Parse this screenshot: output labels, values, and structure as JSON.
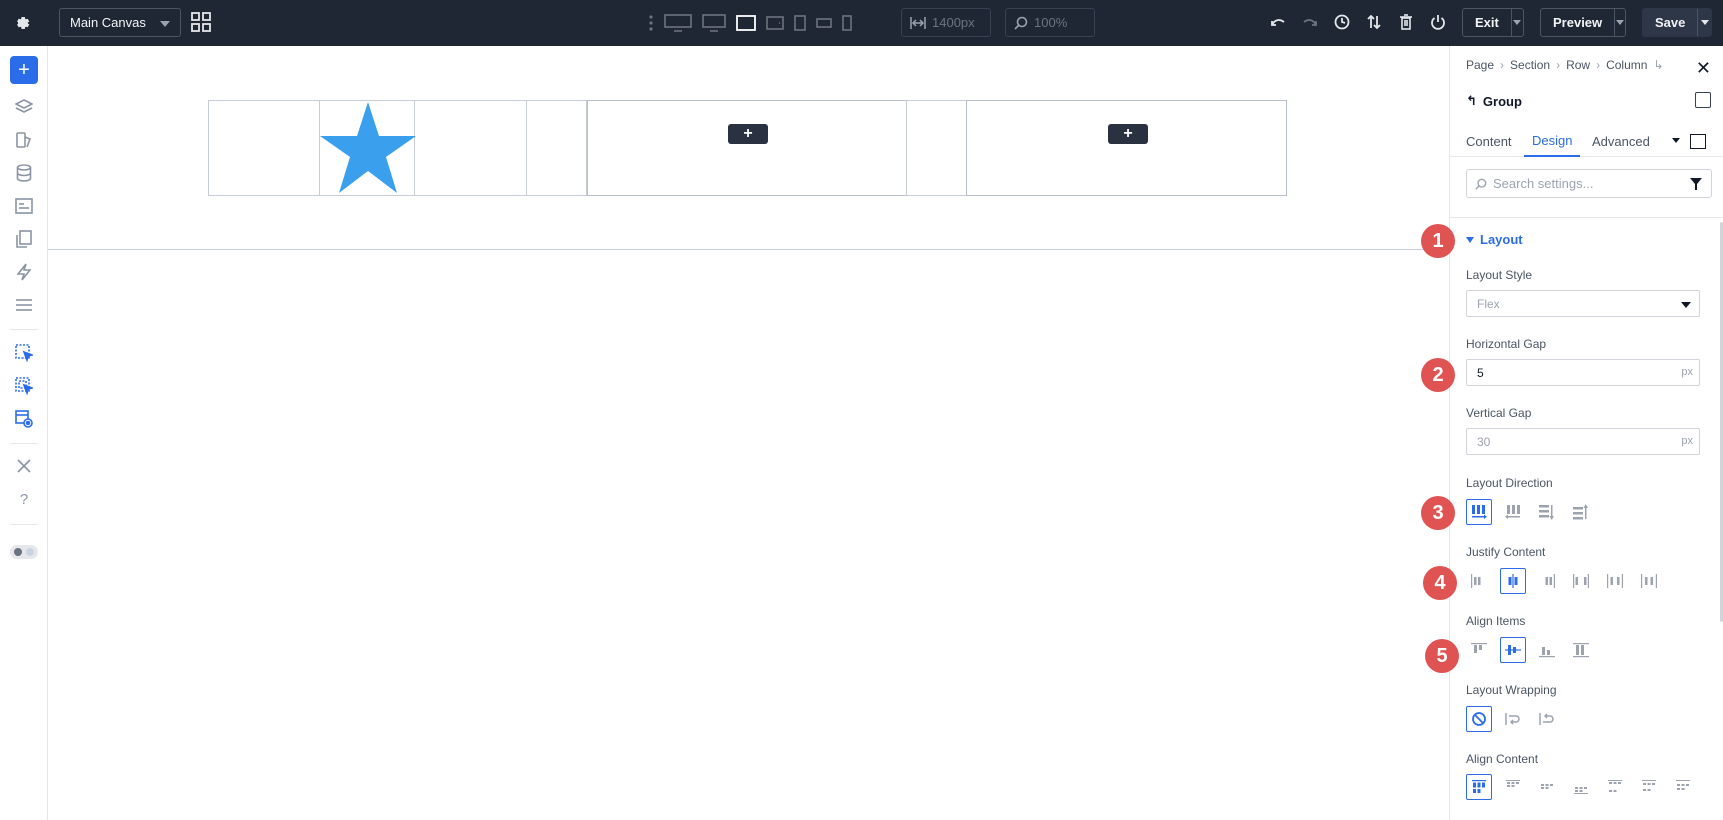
{
  "topbar": {
    "canvas_select": "Main Canvas",
    "width_readout": "1400px",
    "zoom_readout": "100%",
    "exit_label": "Exit",
    "preview_label": "Preview",
    "save_label": "Save"
  },
  "panel": {
    "breadcrumbs": [
      "Page",
      "Section",
      "Row",
      "Column"
    ],
    "group_title": "Group",
    "tabs": [
      "Content",
      "Design",
      "Advanced"
    ],
    "active_tab": "Design",
    "search_placeholder": "Search settings...",
    "layout_section": "Layout",
    "layout_style_label": "Layout Style",
    "layout_style_value": "Flex",
    "horizontal_gap_label": "Horizontal Gap",
    "horizontal_gap_value": "5",
    "horizontal_gap_unit": "px",
    "vertical_gap_label": "Vertical Gap",
    "vertical_gap_value": "30",
    "vertical_gap_unit": "px",
    "layout_direction_label": "Layout Direction",
    "justify_content_label": "Justify Content",
    "align_items_label": "Align Items",
    "layout_wrapping_label": "Layout Wrapping",
    "align_content_label": "Align Content"
  },
  "callouts": [
    "1",
    "2",
    "3",
    "4",
    "5"
  ],
  "colors": {
    "accent": "#2b6de9",
    "topbar": "#1f2735",
    "star": "#3aa0ee",
    "callout": "#e05353"
  },
  "canvas": {
    "add_symbol": "+"
  }
}
